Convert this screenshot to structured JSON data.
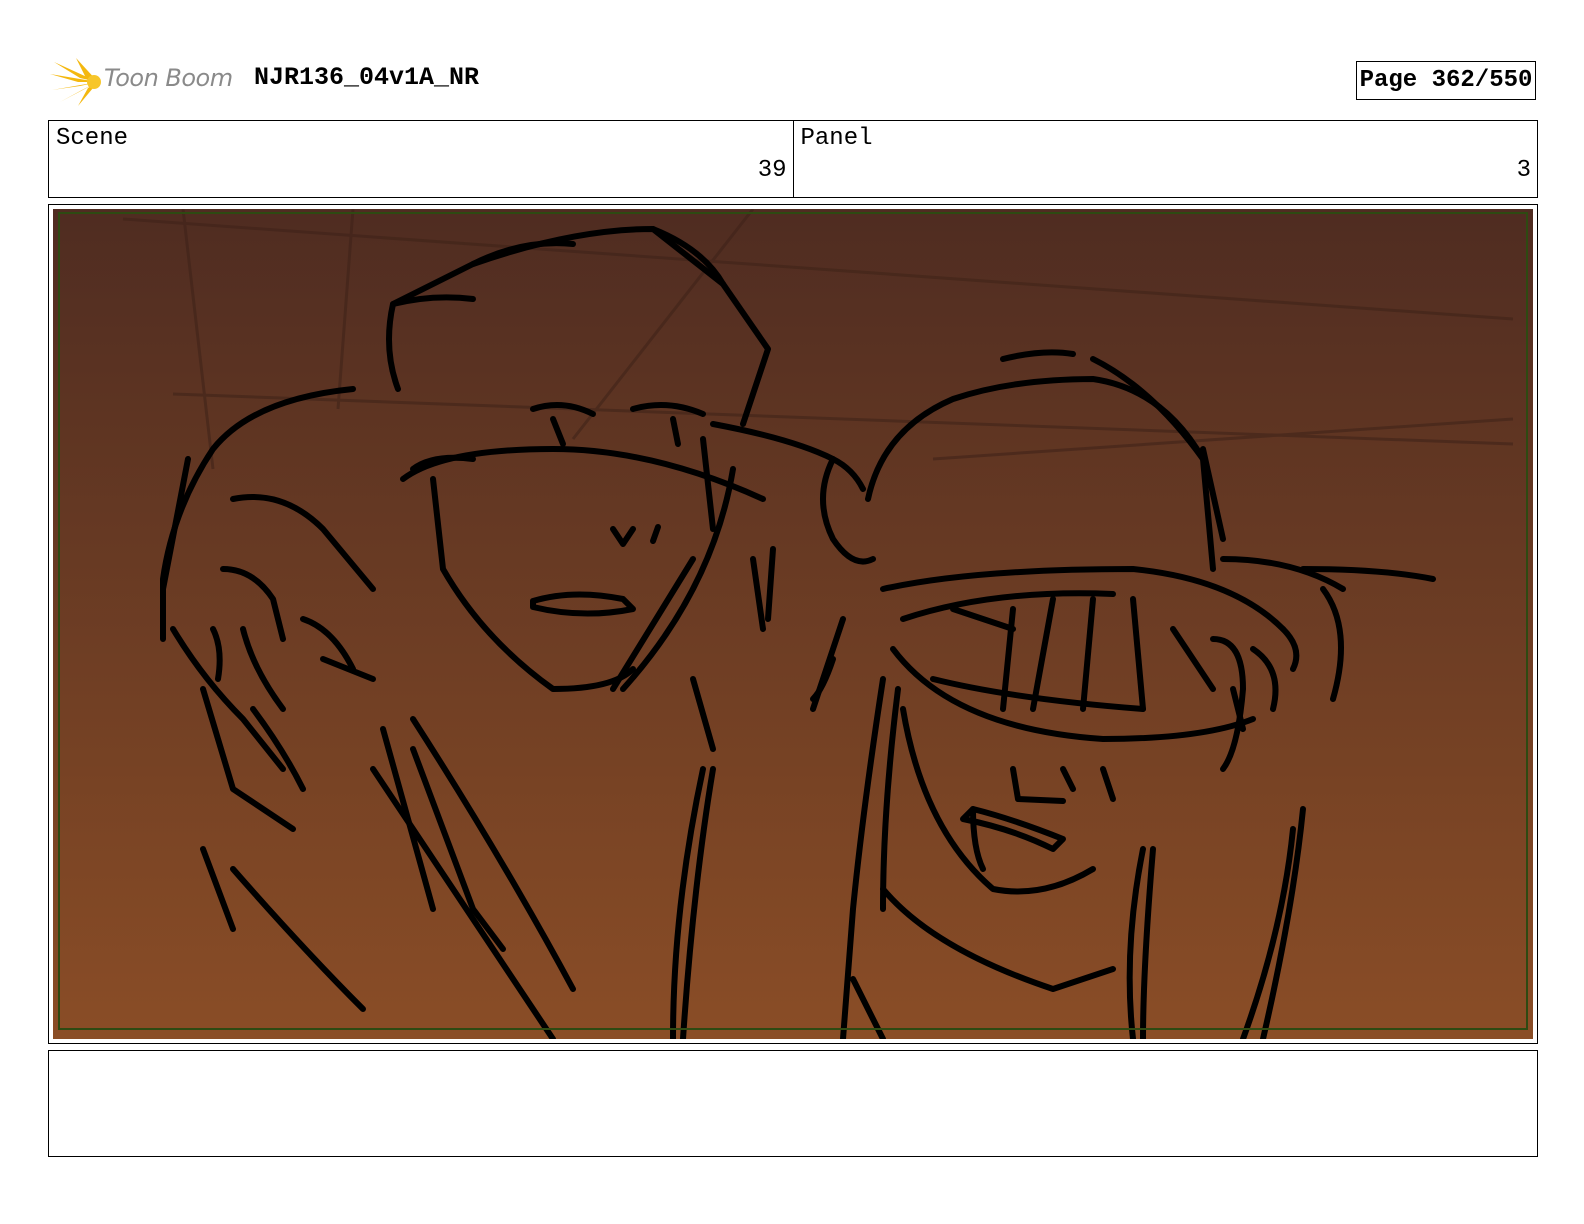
{
  "header": {
    "logo_text": "Toon Boom",
    "project_title": "NJR136_04v1A_NR",
    "page_indicator": "Page 362/550"
  },
  "info": {
    "scene_label": "Scene",
    "scene_value": "39",
    "panel_label": "Panel",
    "panel_value": "3"
  },
  "frame": {
    "bg_top": "#4f2c21",
    "bg_bottom": "#8a4d26",
    "safe_area_color": "#2e4a12",
    "line_color": "#000000"
  },
  "notes": {
    "text": ""
  }
}
